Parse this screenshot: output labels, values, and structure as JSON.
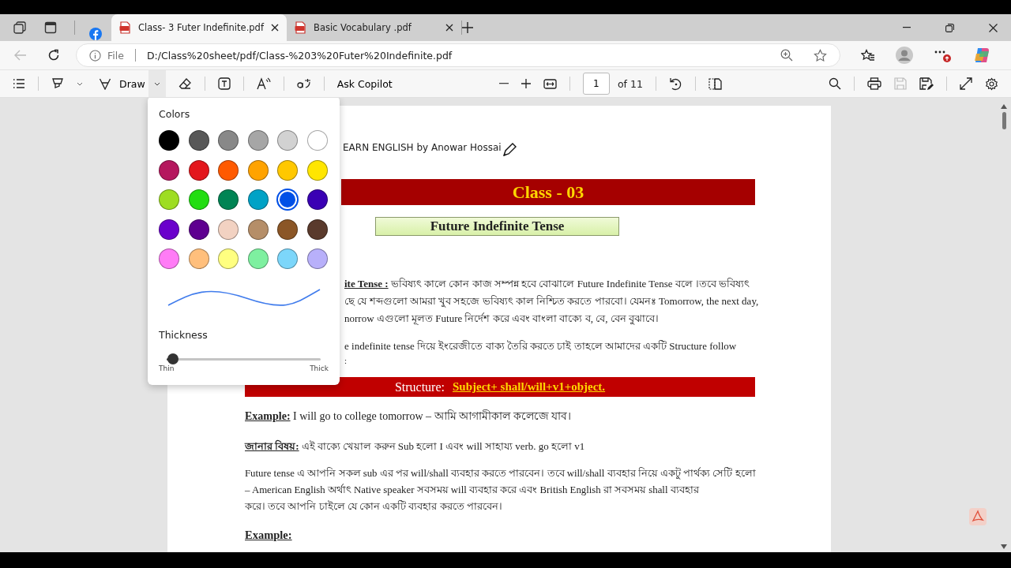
{
  "tabs": [
    {
      "kind": "facebook",
      "selected": false
    },
    {
      "kind": "pdf",
      "title": "Class- 3 Futer Indefinite.pdf",
      "selected": true
    },
    {
      "kind": "pdf",
      "title": "Basic Vocabulary .pdf",
      "selected": false
    }
  ],
  "address_bar": {
    "scheme_label": "File",
    "url": "D:/Class%20sheet/pdf/Class-%203%20Futer%20Indefinite.pdf"
  },
  "pdf_toolbar": {
    "draw_label": "Draw",
    "copilot_label": "Ask Copilot",
    "page_number": "1",
    "page_count": "of 11"
  },
  "draw_popup": {
    "colors_label": "Colors",
    "colors": [
      {
        "color": "#000000",
        "selected": false
      },
      {
        "color": "#585858",
        "selected": false
      },
      {
        "color": "#888888",
        "selected": false
      },
      {
        "color": "#a6a6a6",
        "selected": false
      },
      {
        "color": "#d2d2d2",
        "selected": false
      },
      {
        "color": "#ffffff",
        "selected": false
      },
      {
        "color": "#b5175e",
        "selected": false
      },
      {
        "color": "#e3161c",
        "selected": false
      },
      {
        "color": "#ff5a00",
        "selected": false
      },
      {
        "color": "#ffa300",
        "selected": false
      },
      {
        "color": "#ffc800",
        "selected": false
      },
      {
        "color": "#ffe600",
        "selected": false
      },
      {
        "color": "#9edd22",
        "selected": false
      },
      {
        "color": "#22dd11",
        "selected": false
      },
      {
        "color": "#008454",
        "selected": false
      },
      {
        "color": "#00a2c6",
        "selected": false
      },
      {
        "color": "#0050e6",
        "selected": true
      },
      {
        "color": "#3a00b4",
        "selected": false
      },
      {
        "color": "#6a00cc",
        "selected": false
      },
      {
        "color": "#5e0090",
        "selected": false
      },
      {
        "color": "#f2d2c2",
        "selected": false
      },
      {
        "color": "#b58e68",
        "selected": false
      },
      {
        "color": "#8b5626",
        "selected": false
      },
      {
        "color": "#5a3a2c",
        "selected": false
      },
      {
        "color": "#ff7cf6",
        "selected": false
      },
      {
        "color": "#ffbf7c",
        "selected": false
      },
      {
        "color": "#ffff80",
        "selected": false
      },
      {
        "color": "#7ef0a0",
        "selected": false
      },
      {
        "color": "#7cd6fa",
        "selected": false
      },
      {
        "color": "#b8b0fa",
        "selected": false
      }
    ],
    "thickness_label": "Thickness",
    "thickness": {
      "level": 0.04
    },
    "min_label": "Thin",
    "max_label": "Thick"
  },
  "document": {
    "header": "EARN ENGLISH by Anowar Hossai",
    "class_banner": "Class - 03",
    "topic_box": "Future Indefinite Tense",
    "definition_lines": [
      "**ite Tense :** ভবিষ্যৎ কালে কোন কাজ সম্পন্ন হবে বোঝালে Future Indefinite Tense বলে ।তবে ভবিষ্যৎ",
      "ছে যে শব্দগুলো আমরা খুব সহজে ভবিষ্যৎ কাল নিশ্চিত করতে পারবো। যেমনঃ Tomorrow, the next day,",
      "norrow এগুলো মূলত Future নির্দেশ করে এবং বাংলা বাক্যে ব, বে, বেন বুঝাবে।"
    ],
    "usage_lines": [
      "e indefinite tense দিয়ে ইংরেজীতে বাক্য তৈরি করতে চাই তাহলে আমাদের একটি Structure follow",
      ":"
    ],
    "structure_label": "Structure:",
    "structure_formula": "Subject+ shall/will+v1+object.",
    "example": "**Example:** I will go to college tomorrow – আমি আগামীকাল কলেজে যাব।",
    "note": "**জানার বিষয়:** এই বাক্যে খেয়াল করুন Sub হলো I এবং will সাহায্য  verb.  go হলো v1",
    "paragraph_lines": [
      "Future tense এ আপনি সকল sub এর পর will/shall ব্যবহার করতে পারবেন। তবে will/shall ব্যবহার নিয়ে একটু পার্থক্য সেটি হলো",
      "– American English অর্থাৎ Native speaker সবসময় will ব্যবহার  করে এবং British English রা সবসময় shall ব্যবহার",
      "করে। তবে আপনি চাইলে যে কোন একটি ব্যবহার করতে পারবেন।"
    ],
    "example_heading": "Example:"
  }
}
